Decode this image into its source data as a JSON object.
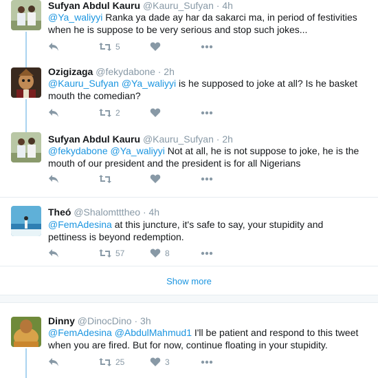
{
  "tweets": [
    {
      "name": "Sufyan Abdul Kauru",
      "handle": "@Kauru_Sufyan",
      "time": "· 4h",
      "text_parts": [
        {
          "t": "@Ya_waliyyi",
          "mention": true
        },
        {
          "t": " Ranka ya dade ay har da sakarci ma, in period of festivities when he is suppose to be very serious and stop such jokes...",
          "mention": false
        }
      ],
      "retweets": "5",
      "likes": ""
    },
    {
      "name": "Ozigizaga",
      "handle": "@fekydabone",
      "time": "· 2h",
      "text_parts": [
        {
          "t": "@Kauru_Sufyan",
          "mention": true
        },
        {
          "t": " ",
          "mention": false
        },
        {
          "t": "@Ya_waliyyi",
          "mention": true
        },
        {
          "t": " is he supposed to joke at all? Is he basket mouth the comedian?",
          "mention": false
        }
      ],
      "retweets": "2",
      "likes": ""
    },
    {
      "name": "Sufyan Abdul Kauru",
      "handle": "@Kauru_Sufyan",
      "time": "· 2h",
      "text_parts": [
        {
          "t": "@fekydabone",
          "mention": true
        },
        {
          "t": " ",
          "mention": false
        },
        {
          "t": "@Ya_waliyyi",
          "mention": true
        },
        {
          "t": " Not at all, he is not suppose to joke, he is the mouth of our president and the president is for all Nigerians",
          "mention": false
        }
      ],
      "retweets": "",
      "likes": ""
    },
    {
      "name": "Theó",
      "handle": "@Shalomtttheo",
      "time": "· 4h",
      "text_parts": [
        {
          "t": "@FemAdesina",
          "mention": true
        },
        {
          "t": " at this juncture, it's safe to say, your stupidity and pettiness is beyond redemption.",
          "mention": false
        }
      ],
      "retweets": "57",
      "likes": "8"
    },
    {
      "name": "Dinny",
      "handle": "@DinocDino",
      "time": "· 3h",
      "text_parts": [
        {
          "t": "@FemAdesina",
          "mention": true
        },
        {
          "t": " ",
          "mention": false
        },
        {
          "t": "@AbdulMahmud1",
          "mention": true
        },
        {
          "t": " I'll be patient and respond to this tweet when you are fired. But for now, continue floating in your stupidity.",
          "mention": false
        }
      ],
      "retweets": "25",
      "likes": "3"
    }
  ],
  "show_more_label": "Show more",
  "icons": {
    "reply": "reply-icon",
    "retweet": "retweet-icon",
    "like": "heart-icon",
    "more": "more-icon"
  },
  "colors": {
    "link": "#1b95e0",
    "muted": "#8899a6",
    "thread": "#a9d3f0",
    "divider": "#e6ecf0"
  }
}
